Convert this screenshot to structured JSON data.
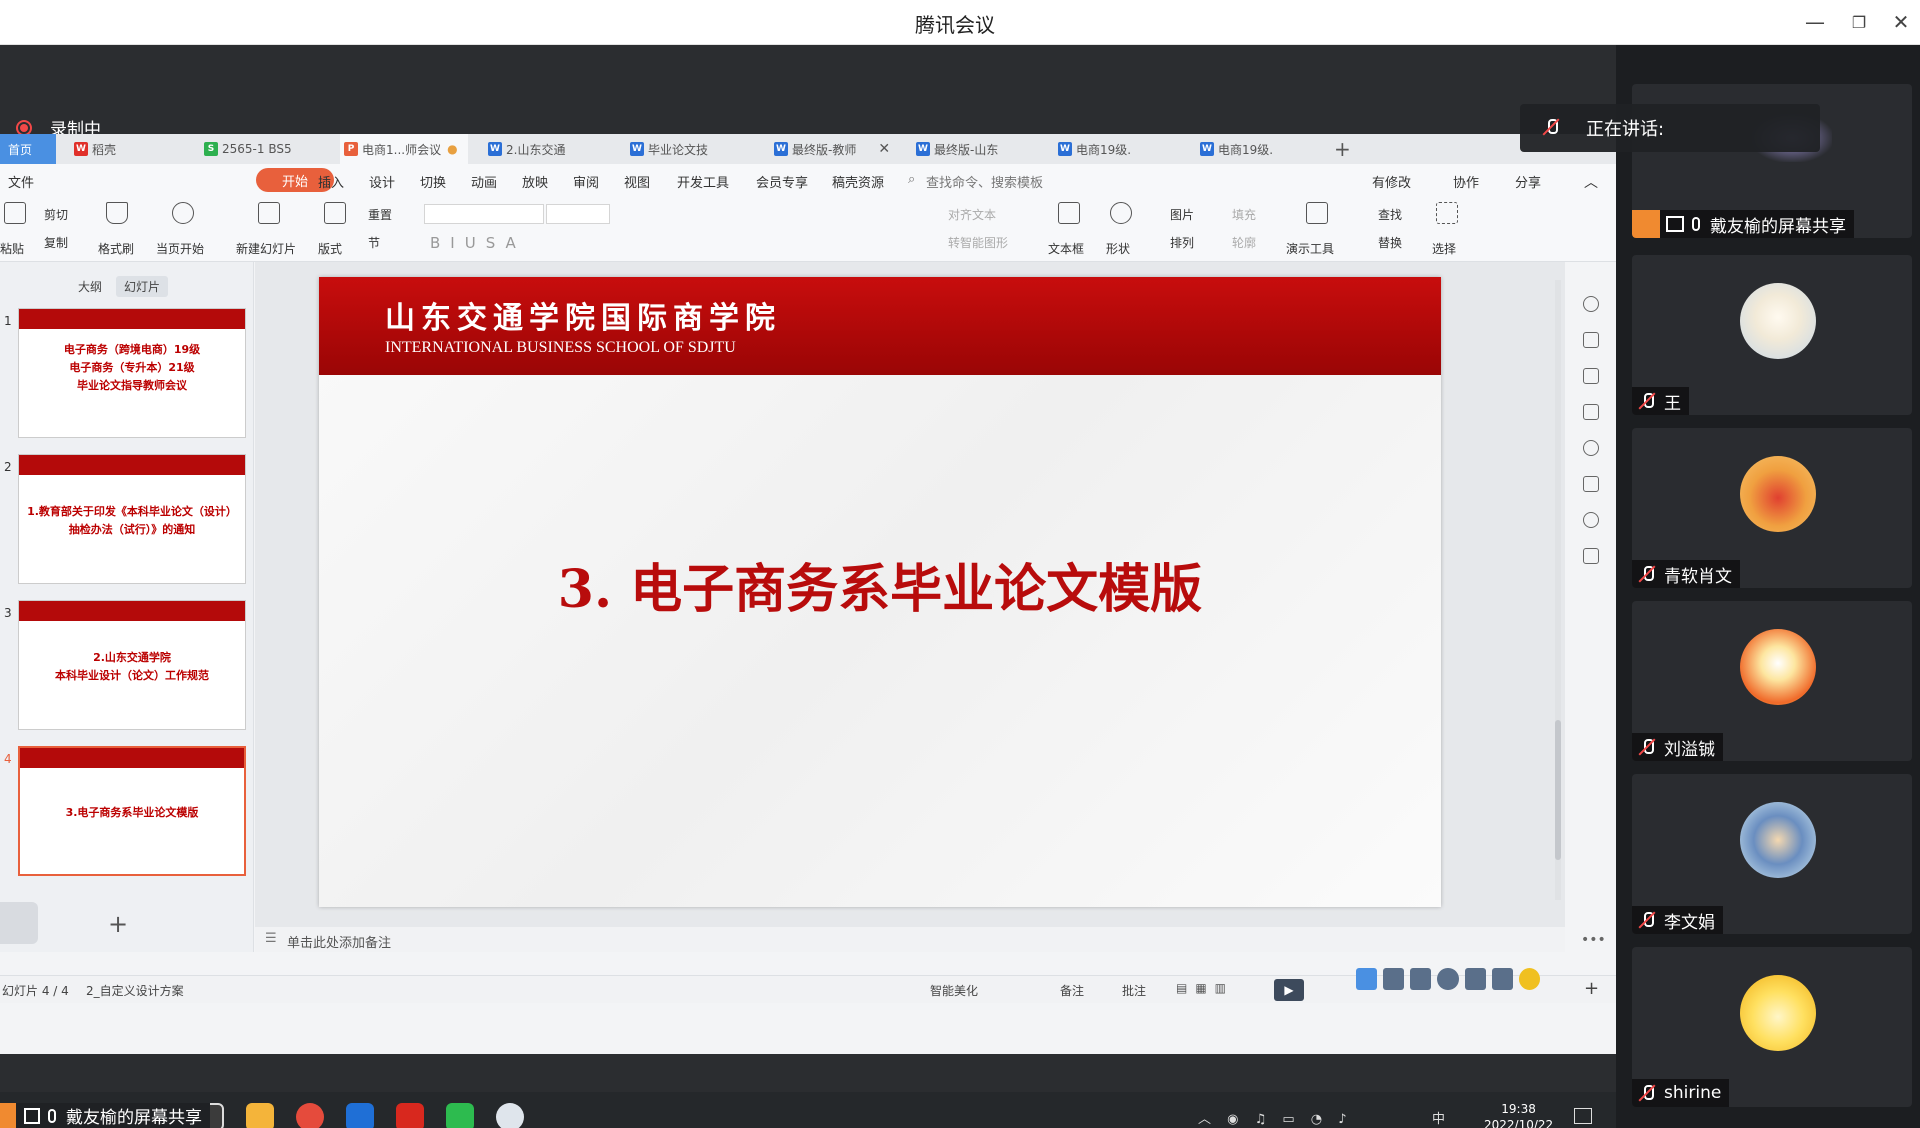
{
  "app": {
    "title": "腾讯会议"
  },
  "recording": {
    "label": "录制中"
  },
  "doc_tabs": [
    {
      "label": "首页"
    },
    {
      "label": "稻壳"
    },
    {
      "label": "2565-1 BS5"
    },
    {
      "label": "电商1...师会议"
    },
    {
      "label": "2.山东交通"
    },
    {
      "label": "毕业论文技"
    },
    {
      "label": "最终版-教师"
    },
    {
      "label": "最终版-山东"
    },
    {
      "label": "电商19级."
    },
    {
      "label": "电商19级."
    }
  ],
  "menu": {
    "file": "文件",
    "items": [
      "开始",
      "插入",
      "设计",
      "切换",
      "动画",
      "放映",
      "审阅",
      "视图",
      "开发工具",
      "会员专享",
      "稿壳资源"
    ],
    "search": "查找命令、搜索模板",
    "right": [
      "有修改",
      "协作",
      "分享"
    ]
  },
  "ribbon": {
    "paste": "粘贴",
    "cut": "剪切",
    "copy": "复制",
    "format_painter": "格式刷",
    "play_from_current": "当页开始",
    "new_slide": "新建幻灯片",
    "layout": "版式",
    "section": "节",
    "reset": "重置",
    "align_text": "对齐文本",
    "convert_smart": "转智能图形",
    "textbox": "文本框",
    "shape": "形状",
    "picture": "图片",
    "arrange": "排列",
    "fill": "填充",
    "outline": "轮廓",
    "presentation_tools": "演示工具",
    "find": "查找",
    "replace": "替换",
    "select": "选择"
  },
  "nav": {
    "outline_tab": "大纲",
    "slides_tab": "幻灯片",
    "slides": [
      {
        "num": "1",
        "lines": [
          "电子商务（跨境电商）19级",
          "电子商务（专升本）21级",
          "毕业论文指导教师会议"
        ]
      },
      {
        "num": "2",
        "lines": [
          "1.教育部关于印发《本科毕业论文（设计）",
          "抽检办法（试行）》的通知"
        ]
      },
      {
        "num": "3",
        "lines": [
          "2.山东交通学院",
          "本科毕业设计（论文）工作规范"
        ]
      },
      {
        "num": "4",
        "lines": [
          "3.电子商务系毕业论文模版"
        ]
      }
    ]
  },
  "slide": {
    "school_cn": "山东交通学院国际商学院",
    "school_en": "INTERNATIONAL BUSINESS SCHOOL OF SDJTU",
    "title": "3. 电子商务系毕业论文模版"
  },
  "notes": {
    "placeholder": "单击此处添加备注"
  },
  "status": {
    "slide_count": "幻灯片 4 / 4",
    "theme": "2_自定义设计方案",
    "beautify": "智能美化",
    "notes": "备注",
    "comment": "批注"
  },
  "taskbar": {
    "time": "19:38",
    "date": "2022/10/22",
    "ime": "中"
  },
  "share_label": "戴友榆的屏幕共享",
  "speaking": {
    "label": "正在讲话:"
  },
  "participants": [
    {
      "name": "戴友榆的屏幕共享",
      "color": "#3a3d44"
    },
    {
      "name": "王",
      "color": "#e9eef4"
    },
    {
      "name": "青软肖文",
      "color": "#f0a040"
    },
    {
      "name": "刘溢铖",
      "color": "#f06a2a"
    },
    {
      "name": "李文娟",
      "color": "#cfe6f0"
    },
    {
      "name": "shirine",
      "color": "#fff3a0"
    }
  ],
  "colors": {
    "accent": "#e8603c",
    "slide_red": "#b80c0c",
    "panel_bg": "#1c1e21"
  }
}
